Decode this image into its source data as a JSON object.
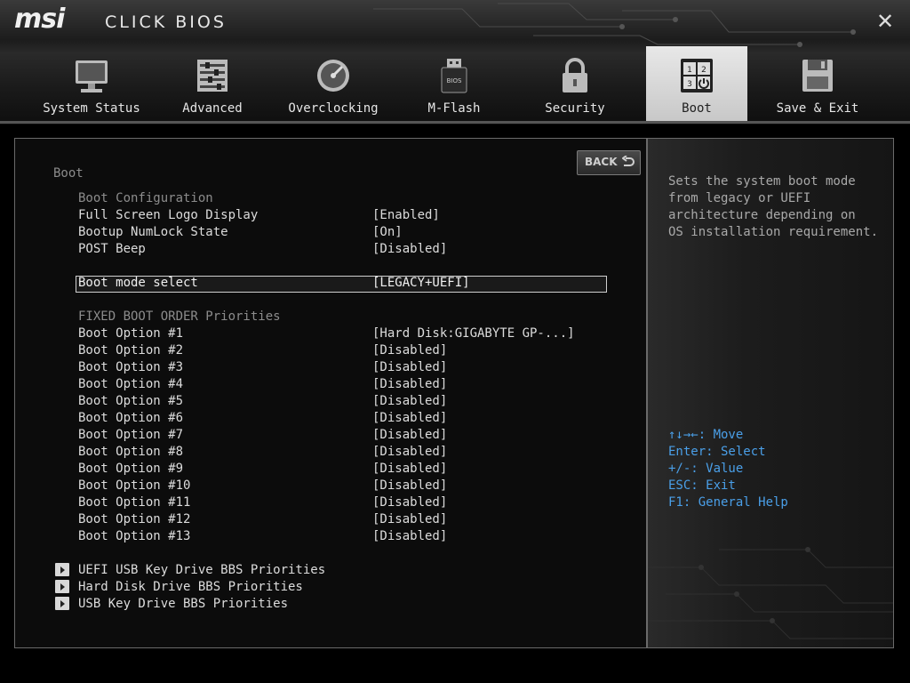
{
  "header": {
    "brand_msi": "msi",
    "brand_bios": "CLICK BIOS",
    "close_symbol": "✕",
    "tabs": [
      {
        "label": "System Status",
        "icon": "monitor-icon"
      },
      {
        "label": "Advanced",
        "icon": "sliders-icon"
      },
      {
        "label": "Overclocking",
        "icon": "gauge-icon"
      },
      {
        "label": "M-Flash",
        "icon": "usb-bios-icon"
      },
      {
        "label": "Security",
        "icon": "padlock-icon"
      },
      {
        "label": "Boot",
        "icon": "boot-order-icon"
      },
      {
        "label": "Save & Exit",
        "icon": "floppy-disk-icon"
      }
    ],
    "active_tab": "Boot"
  },
  "main": {
    "title": "Boot",
    "back_label": "BACK",
    "boot_config_header": "Boot Configuration",
    "config_items": [
      {
        "label": "Full Screen Logo Display",
        "value": "[Enabled]"
      },
      {
        "label": "Bootup NumLock State",
        "value": "[On]"
      },
      {
        "label": "POST Beep",
        "value": "[Disabled]"
      }
    ],
    "boot_mode": {
      "label": "Boot mode select",
      "value": "[LEGACY+UEFI]"
    },
    "fixed_order_header": "FIXED BOOT ORDER Priorities",
    "boot_options": [
      {
        "label": "Boot Option #1",
        "value": "[Hard Disk:GIGABYTE GP-...]"
      },
      {
        "label": "Boot Option #2",
        "value": "[Disabled]"
      },
      {
        "label": "Boot Option #3",
        "value": "[Disabled]"
      },
      {
        "label": "Boot Option #4",
        "value": "[Disabled]"
      },
      {
        "label": "Boot Option #5",
        "value": "[Disabled]"
      },
      {
        "label": "Boot Option #6",
        "value": "[Disabled]"
      },
      {
        "label": "Boot Option #7",
        "value": "[Disabled]"
      },
      {
        "label": "Boot Option #8",
        "value": "[Disabled]"
      },
      {
        "label": "Boot Option #9",
        "value": "[Disabled]"
      },
      {
        "label": "Boot Option #10",
        "value": "[Disabled]"
      },
      {
        "label": "Boot Option #11",
        "value": "[Disabled]"
      },
      {
        "label": "Boot Option #12",
        "value": "[Disabled]"
      },
      {
        "label": "Boot Option #13",
        "value": "[Disabled]"
      }
    ],
    "submenus": [
      "UEFI USB Key Drive BBS Priorities",
      "Hard Disk Drive BBS Priorities",
      "USB Key Drive BBS Priorities"
    ]
  },
  "help": {
    "description": [
      "Sets the system boot mode",
      "from legacy or UEFI",
      "architecture depending on",
      "OS installation requirement."
    ],
    "keys": [
      "↑↓→←: Move",
      "Enter: Select",
      "+/-: Value",
      "ESC: Exit",
      "F1: General Help"
    ]
  },
  "colors": {
    "accent_blue": "#4a9fe8",
    "section_gray": "#8c8c8c",
    "active_tab_bg": "#d8d8d8"
  }
}
